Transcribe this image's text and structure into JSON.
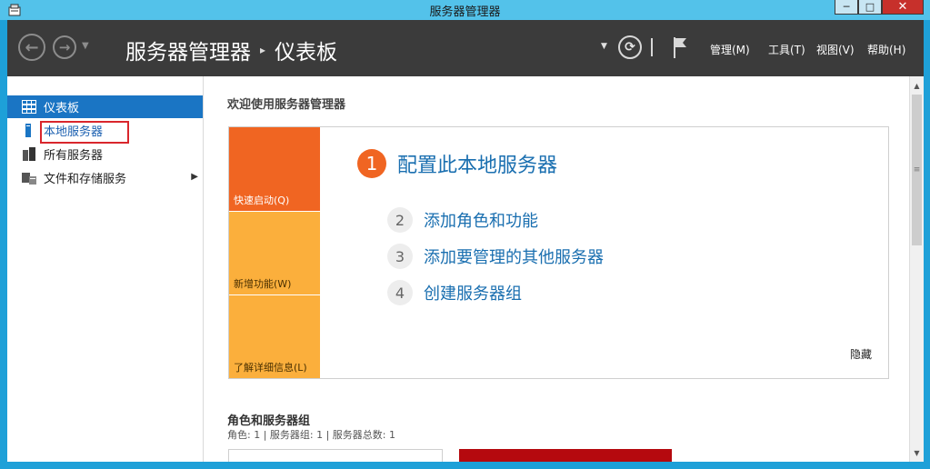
{
  "window": {
    "title": "服务器管理器",
    "minimize": "─",
    "maximize": "□",
    "close": "✕"
  },
  "header": {
    "breadcrumb_root": "服务器管理器",
    "breadcrumb_sep": "▸",
    "breadcrumb_current": "仪表板",
    "menus": [
      "管理(M)",
      "工具(T)",
      "视图(V)",
      "帮助(H)"
    ],
    "icons": {
      "back": "back-arrow-icon",
      "forward": "forward-arrow-icon",
      "refresh": "refresh-icon",
      "flag": "notification-flag-icon"
    }
  },
  "sidebar": {
    "items": [
      {
        "label": "仪表板",
        "icon": "dashboard-grid-icon",
        "active": true
      },
      {
        "label": "本地服务器",
        "icon": "server-icon"
      },
      {
        "label": "所有服务器",
        "icon": "servers-icon"
      },
      {
        "label": "文件和存储服务",
        "icon": "storage-icon",
        "expandable": true
      }
    ]
  },
  "main": {
    "welcome": "欢迎使用服务器管理器",
    "tiles": [
      "快速启动(Q)",
      "新增功能(W)",
      "了解详细信息(L)"
    ],
    "steps": [
      {
        "num": "1",
        "label": "配置此本地服务器"
      },
      {
        "num": "2",
        "label": "添加角色和功能"
      },
      {
        "num": "3",
        "label": "添加要管理的其他服务器"
      },
      {
        "num": "4",
        "label": "创建服务器组"
      }
    ],
    "hide": "隐藏",
    "roles_title": "角色和服务器组",
    "roles_summary": "角色: 1 | 服务器组: 1 | 服务器总数: 1"
  },
  "colors": {
    "accent_orange": "#f06522",
    "tile_yellow": "#fbaf3c",
    "link_blue": "#1a6fb0",
    "header_bg": "#3b3b3b",
    "selected_blue": "#1a75c4",
    "alert_red": "#b5090e"
  }
}
